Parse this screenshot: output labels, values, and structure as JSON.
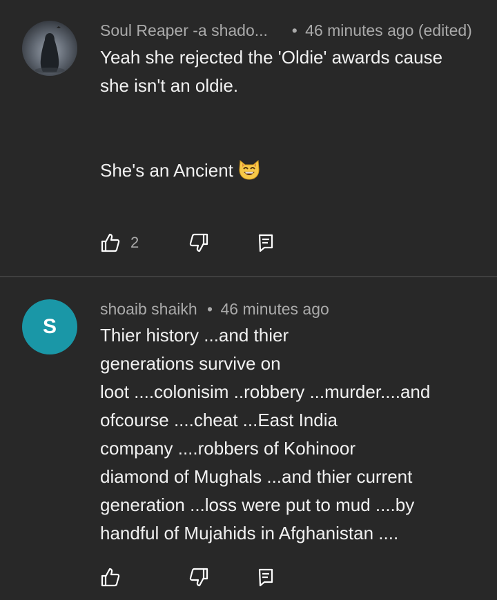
{
  "comments": [
    {
      "author": "Soul Reaper -a shado...",
      "separator": "•",
      "time": "46 minutes ago (edited)",
      "text": "Yeah she rejected the 'Oldie' awards cause\nshe isn't an oldie.\n\n\nShe's an Ancient",
      "emoji": "grinning-cat-emoji",
      "like_count": "2",
      "avatar_icon": "dark-figure-avatar"
    },
    {
      "author": "shoaib shaikh",
      "separator": "•",
      "time": "46 minutes ago",
      "text": "Thier history ...and thier\ngenerations survive on\nloot ....colonisim ..robbery ...murder....and\nofcourse ....cheat ...East India\ncompany ....robbers of Kohinoor\ndiamond of Mughals ...and thier current\ngeneration ...loss were put to mud ....by\nhandful of Mujahids in Afghanistan ....",
      "avatar_letter": "S",
      "avatar_color": "#1a97a7"
    }
  ],
  "colors": {
    "background": "#282828",
    "text": "#f1f1f1",
    "meta": "#aaaaaa",
    "divider": "#3f3f3f"
  },
  "icons": [
    "thumb-up-icon",
    "thumb-down-icon",
    "reply-icon"
  ]
}
